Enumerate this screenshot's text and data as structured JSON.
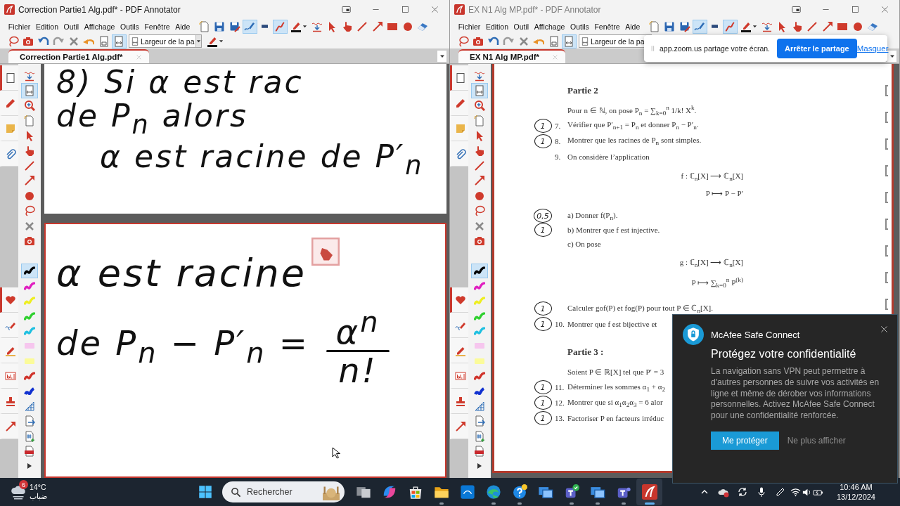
{
  "windows": [
    {
      "title": "Correction Partie1 Alg.pdf* - PDF Annotator",
      "active": true,
      "menu": [
        "Fichier",
        "Edition",
        "Outil",
        "Affichage",
        "Outils",
        "Fenêtre",
        "Aide"
      ],
      "toolbar_row_1": [
        {
          "kind": "new",
          "selected": false
        },
        {
          "kind": "save",
          "selected": false
        },
        {
          "kind": "saveas",
          "selected": false
        },
        {
          "kind": "pen",
          "selected": true
        },
        {
          "kind": "linewidth",
          "selected": false
        },
        {
          "kind": "curve",
          "selected": true
        },
        {
          "kind": "color",
          "selected": false
        },
        {
          "kind": "insert",
          "selected": false
        },
        {
          "kind": "select",
          "selected": false
        },
        {
          "kind": "hand",
          "selected": false
        },
        {
          "kind": "line",
          "selected": false
        },
        {
          "kind": "arrow",
          "selected": false
        },
        {
          "kind": "rect",
          "selected": false
        },
        {
          "kind": "circle",
          "selected": false
        },
        {
          "kind": "eraser",
          "selected": false
        }
      ],
      "toolbar_row_2": [
        {
          "kind": "lasso",
          "selected": false
        },
        {
          "kind": "camera",
          "selected": false
        },
        {
          "kind": "undo",
          "selected": false
        },
        {
          "kind": "redo",
          "selected": false
        },
        {
          "kind": "delete",
          "selected": false
        },
        {
          "kind": "revert",
          "selected": false
        },
        {
          "kind": "fitpage",
          "selected": false
        },
        {
          "kind": "fitwidth",
          "selected": true
        }
      ],
      "zoom_field": {
        "value": "Largeur de la pa"
      },
      "toolbar_row_2_end": [
        {
          "kind": "color",
          "selected": false
        }
      ],
      "tab": {
        "label": "Correction Partie1 Alg.pdf*",
        "selected": true
      },
      "side_panel": {
        "top_tabs": [
          {
            "kind": "thumbs",
            "selected": true
          },
          {
            "kind": "spen",
            "selected": false
          },
          {
            "kind": "note",
            "selected": false
          },
          {
            "kind": "clip",
            "selected": false
          }
        ],
        "bottom_tabs": [
          {
            "kind": "heart",
            "selected": true
          },
          {
            "kind": "signature",
            "selected": false
          },
          {
            "kind": "highlight",
            "selected": false
          },
          {
            "kind": "textfield",
            "selected": false
          },
          {
            "kind": "stamp",
            "selected": false
          },
          {
            "kind": "arrow",
            "selected": false
          }
        ]
      },
      "tools": [
        {
          "kind": "insert",
          "selected": false
        },
        {
          "kind": "fitwidth",
          "selected": true
        },
        {
          "kind": "zoom",
          "selected": false
        },
        {
          "kind": "new",
          "selected": false
        },
        {
          "kind": "select",
          "selected": false
        },
        {
          "kind": "hand",
          "selected": false
        },
        {
          "kind": "line",
          "selected": false
        },
        {
          "kind": "arrow",
          "selected": false
        },
        {
          "kind": "circle",
          "selected": false
        },
        {
          "kind": "lasso",
          "selected": false
        },
        {
          "kind": "delete",
          "selected": false
        },
        {
          "kind": "camera",
          "selected": false
        }
      ],
      "pens": [
        {
          "kind": "marker",
          "color": "#000000",
          "selected": true
        },
        {
          "kind": "marker",
          "color": "#e020c0",
          "selected": false
        },
        {
          "kind": "marker",
          "color": "#eeee22",
          "selected": false
        },
        {
          "kind": "marker",
          "color": "#30d030",
          "selected": false
        },
        {
          "kind": "marker",
          "color": "#20c0e0",
          "selected": false
        },
        {
          "kind": "pcf",
          "color": "#f6c6ee",
          "selected": false
        },
        {
          "kind": "pcf",
          "color": "#fbfb9a",
          "selected": false
        },
        {
          "kind": "marker",
          "color": "#d0342c",
          "selected": false
        },
        {
          "kind": "thick",
          "color": "#1030d0",
          "selected": false
        },
        {
          "kind": "grid",
          "selected": false
        },
        {
          "kind": "export",
          "selected": false
        },
        {
          "kind": "number",
          "selected": false
        },
        {
          "kind": "pdf",
          "selected": false
        },
        {
          "kind": "more",
          "selected": false
        }
      ],
      "document": {
        "kind": "handwriting",
        "pages": [
          {
            "selected": false,
            "lines": [
              {
                "text": "8) Si α est rac"
              },
              {
                "text": "de P$_{n}$ alors"
              },
              {
                "text": "α est racine de P′$_{n}$"
              }
            ]
          },
          {
            "selected": true,
            "lines": [
              {
                "text": "α est racine"
              },
              {
                "text": "de P$_{n}$ − P′$_{n}$ =",
                "fraction": {
                  "numerator": "α$^{n}$",
                  "denominator": "n!"
                }
              }
            ]
          }
        ]
      }
    },
    {
      "title": "EX N1 Alg MP.pdf* - PDF Annotator",
      "active": false,
      "menu": [
        "Fichier",
        "Edition",
        "Outil",
        "Affichage",
        "Outils",
        "Fenêtre",
        "Aide"
      ],
      "toolbar_row_1": [
        {
          "kind": "new",
          "selected": false
        },
        {
          "kind": "save",
          "selected": false
        },
        {
          "kind": "saveas",
          "selected": false
        },
        {
          "kind": "pen",
          "selected": true
        },
        {
          "kind": "linewidth",
          "selected": false
        },
        {
          "kind": "curve",
          "selected": true
        },
        {
          "kind": "color",
          "selected": false
        },
        {
          "kind": "insert",
          "selected": false
        },
        {
          "kind": "select",
          "selected": false
        },
        {
          "kind": "hand",
          "selected": false
        },
        {
          "kind": "line",
          "selected": false
        },
        {
          "kind": "arrow",
          "selected": false
        },
        {
          "kind": "rect",
          "selected": false
        },
        {
          "kind": "circle",
          "selected": false
        },
        {
          "kind": "eraser",
          "selected": false
        }
      ],
      "toolbar_row_2": [
        {
          "kind": "lasso",
          "selected": false
        },
        {
          "kind": "camera",
          "selected": false
        },
        {
          "kind": "undo",
          "selected": false
        },
        {
          "kind": "redo",
          "selected": false
        },
        {
          "kind": "delete",
          "selected": false
        },
        {
          "kind": "revert",
          "selected": false
        },
        {
          "kind": "fitpage",
          "selected": false
        },
        {
          "kind": "fitwidth",
          "selected": true
        }
      ],
      "zoom_field": {
        "value": "Largeur de la pa"
      },
      "tab": {
        "label": "EX N1 Alg MP.pdf*",
        "selected": true
      },
      "side_panel": {
        "top_tabs": [
          {
            "kind": "thumbs",
            "selected": true
          },
          {
            "kind": "spen",
            "selected": false
          },
          {
            "kind": "note",
            "selected": false
          },
          {
            "kind": "clip",
            "selected": false
          }
        ],
        "bottom_tabs": [
          {
            "kind": "heart",
            "selected": true
          },
          {
            "kind": "signature",
            "selected": false
          },
          {
            "kind": "highlight",
            "selected": false
          },
          {
            "kind": "textfield",
            "selected": false
          },
          {
            "kind": "stamp",
            "selected": false
          },
          {
            "kind": "arrow",
            "selected": false
          }
        ]
      },
      "tools": [
        {
          "kind": "insert",
          "selected": false
        },
        {
          "kind": "fitwidth",
          "selected": true
        },
        {
          "kind": "zoom",
          "selected": false
        },
        {
          "kind": "new",
          "selected": false
        },
        {
          "kind": "select",
          "selected": false
        },
        {
          "kind": "hand",
          "selected": false
        },
        {
          "kind": "line",
          "selected": false
        },
        {
          "kind": "arrow",
          "selected": false
        },
        {
          "kind": "circle",
          "selected": false
        },
        {
          "kind": "lasso",
          "selected": false
        },
        {
          "kind": "delete",
          "selected": false
        },
        {
          "kind": "camera",
          "selected": false
        }
      ],
      "pens": [
        {
          "kind": "marker",
          "color": "#000000",
          "selected": true
        },
        {
          "kind": "marker",
          "color": "#e020c0",
          "selected": false
        },
        {
          "kind": "marker",
          "color": "#eeee22",
          "selected": false
        },
        {
          "kind": "marker",
          "color": "#30d030",
          "selected": false
        },
        {
          "kind": "marker",
          "color": "#20c0e0",
          "selected": false
        },
        {
          "kind": "pcf",
          "color": "#f6c6ee",
          "selected": false
        },
        {
          "kind": "pcf",
          "color": "#fbfb9a",
          "selected": false
        },
        {
          "kind": "marker",
          "color": "#d0342c",
          "selected": false
        },
        {
          "kind": "thick",
          "color": "#1030d0",
          "selected": false
        },
        {
          "kind": "grid",
          "selected": false
        },
        {
          "kind": "export",
          "selected": false
        },
        {
          "kind": "number",
          "selected": false
        },
        {
          "kind": "pdf",
          "selected": false
        },
        {
          "kind": "more",
          "selected": false
        }
      ],
      "document": {
        "kind": "typeset",
        "page": {
          "selected": true,
          "lines": [
            {
              "kind": "heading",
              "text": "Partie 2"
            },
            {
              "kind": "text",
              "text": "Pour n ∈ ℕ, on pose P$_{n}$ = ∑$_{k=0}$$^{n}$ 1/k! X$^{k}$."
            },
            {
              "kind": "item",
              "mark": "1",
              "number": "7.",
              "text": "Vérifier que P′$_{n+1}$ = P$_{n}$ et donner P$_{n}$ − P′$_{n}$."
            },
            {
              "kind": "item",
              "mark": "1",
              "number": "8.",
              "text": "Montrer que les racines de P$_{n}$ sont simples."
            },
            {
              "kind": "item",
              "number": "9.",
              "text": "On considère l’application"
            },
            {
              "kind": "formula",
              "rows": [
                "f : ℂ$_{n}$[X] ⟶ ℂ$_{n}$[X]",
                "P ⟼ P − P′"
              ]
            },
            {
              "kind": "subitem",
              "mark": "0,5",
              "text": "a) Donner f(P$_{n}$)."
            },
            {
              "kind": "subitem",
              "mark": "1",
              "text": "b) Montrer que f est injective."
            },
            {
              "kind": "subitem",
              "text": "c) On pose"
            },
            {
              "kind": "formula",
              "rows": [
                "g : ℂ$_{n}$[X] ⟶ ℂ$_{n}$[X]",
                "P ⟼ ∑$_{k=0}$$^{n}$ P$^{(k)}$"
              ]
            },
            {
              "kind": "text",
              "mark": "1",
              "text": "Calculer gof(P) et fog(P) pour tout P ∈ ℂ$_{n}$[X]."
            },
            {
              "kind": "item",
              "mark": "1",
              "number": "10.",
              "text": "Montrer que f est bijective et"
            },
            {
              "kind": "heading",
              "text": "Partie 3 :"
            },
            {
              "kind": "text",
              "text": "Soient P ∈ ℝ[X] tel que P′ = 3"
            },
            {
              "kind": "item",
              "mark": "1",
              "number": "11.",
              "text": "Déterminer les sommes α$_{1}$ + α$_{2}$"
            },
            {
              "kind": "item",
              "mark": "1",
              "number": "12.",
              "text": "Montrer que si α$_{1}$α$_{2}$α$_{3}$ = 6 alor"
            },
            {
              "kind": "item",
              "mark": "1",
              "number": "13.",
              "text": "Factoriser P en facteurs irréduc"
            }
          ]
        }
      }
    }
  ],
  "share_bar": {
    "message": "app.zoom.us partage votre écran.",
    "stop_button": "Arrêter le partage",
    "hide_link": "Masquer"
  },
  "popup": {
    "app_name": "McAfee Safe Connect",
    "heading": "Protégez votre confidentialité",
    "body": "La navigation sans VPN peut permettre à d'autres personnes de suivre vos activités en ligne et même de dérober vos informations personnelles. Activez McAfee Safe Connect pour une confidentialité renforcée.",
    "buttons": [
      {
        "kind": "primary",
        "label": "Me protéger"
      },
      {
        "kind": "link",
        "label": "Ne plus afficher"
      }
    ]
  },
  "taskbar": {
    "weather": {
      "badge": "6",
      "temperature": "14°C",
      "condition": "ضباب"
    },
    "search": {
      "placeholder": "Rechercher"
    },
    "apps": [
      {
        "kind": "taskview",
        "running": false,
        "selected": false
      },
      {
        "kind": "copilot",
        "running": false,
        "selected": false
      },
      {
        "kind": "store",
        "running": false,
        "selected": false
      },
      {
        "kind": "explorer",
        "running": true,
        "selected": false
      },
      {
        "kind": "hp",
        "running": false,
        "selected": false
      },
      {
        "kind": "edge",
        "running": true,
        "selected": false
      },
      {
        "kind": "help",
        "running": true,
        "selected": false
      },
      {
        "kind": "remote",
        "running": false,
        "selected": false
      },
      {
        "kind": "teamscheck",
        "running": true,
        "selected": false
      },
      {
        "kind": "remote",
        "running": true,
        "selected": false
      },
      {
        "kind": "teams",
        "running": true,
        "selected": false
      },
      {
        "kind": "logo",
        "running": true,
        "selected": true
      }
    ],
    "time": "10:46 AM",
    "date": "13/12/2024"
  }
}
